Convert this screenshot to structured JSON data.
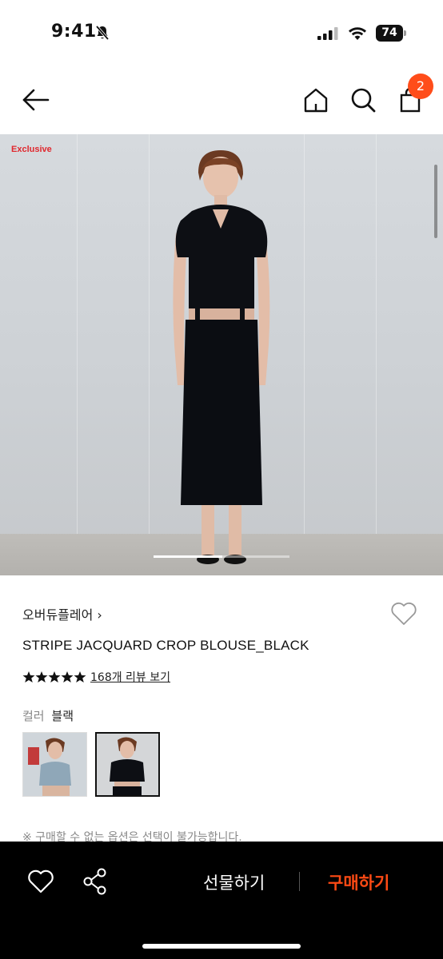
{
  "status_bar": {
    "time": "9:41",
    "battery": "74"
  },
  "nav": {
    "cart_count": "2"
  },
  "hero": {
    "tag": "Exclusive",
    "image_index": 1,
    "image_count": 2
  },
  "product": {
    "brand": "오버듀플레어",
    "brand_chevron": "›",
    "title": "STRIPE JACQUARD CROP BLOUSE_BLACK",
    "rating_stars": 5,
    "review_link": "168개 리뷰 보기",
    "color_label": "컬러",
    "color_value": "블랙",
    "option_notice": "※ 구매할 수 없는 옵션은 선택이 불가능합니다."
  },
  "bottom_bar": {
    "gift_label": "선물하기",
    "buy_label": "구매하기"
  },
  "colors": {
    "accent": "#ff4d1a",
    "exclusive": "#e0282e",
    "bar_bg": "#000000"
  }
}
